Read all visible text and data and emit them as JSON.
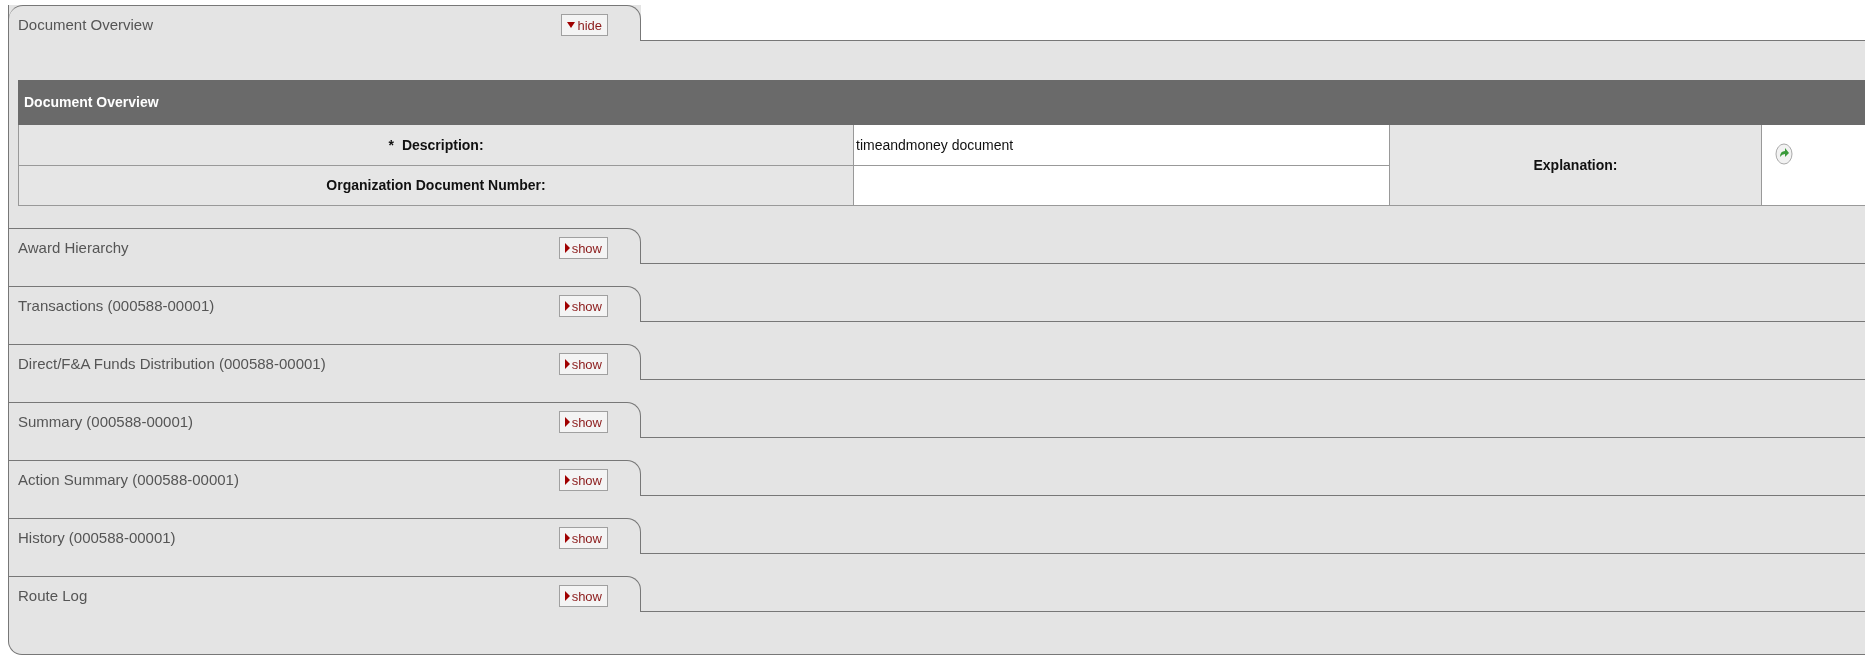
{
  "sections": [
    {
      "title": "Document Overview",
      "toggle": "hide",
      "expanded": true,
      "content": {
        "header": "Document Overview",
        "fields": [
          {
            "label": "Description:",
            "required": true,
            "required_mark": "*",
            "value": "timeandmoney document"
          },
          {
            "label": "Organization Document Number:",
            "required": false
          }
        ],
        "explanation": {
          "label": "Explanation:"
        }
      }
    },
    {
      "title": "Award Hierarchy",
      "toggle": "show",
      "expanded": false
    },
    {
      "title": "Transactions (000588-00001)",
      "toggle": "show",
      "expanded": false
    },
    {
      "title": "Direct/F&A Funds Distribution (000588-00001)",
      "toggle": "show",
      "expanded": false
    },
    {
      "title": "Summary (000588-00001)",
      "toggle": "show",
      "expanded": false
    },
    {
      "title": "Action Summary (000588-00001)",
      "toggle": "show",
      "expanded": false
    },
    {
      "title": "History (000588-00001)",
      "toggle": "show",
      "expanded": false
    },
    {
      "title": "Route Log",
      "toggle": "show",
      "expanded": false
    }
  ]
}
